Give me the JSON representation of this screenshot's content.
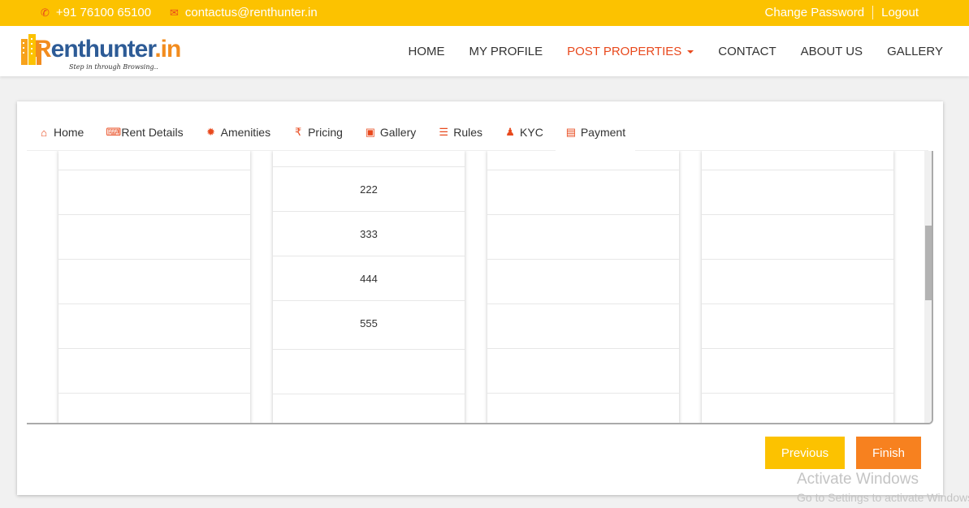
{
  "topbar": {
    "phone": "+91 76100 65100",
    "email": "contactus@renthunter.in",
    "change_password": "Change Password",
    "logout": "Logout"
  },
  "logo": {
    "brand_r": "R",
    "brand_rest": "enthunter",
    "brand_in": ".in",
    "tagline": "Step in through Browsing.."
  },
  "nav": [
    {
      "label": "HOME"
    },
    {
      "label": "MY PROFILE"
    },
    {
      "label": "POST PROPERTIES"
    },
    {
      "label": "CONTACT"
    },
    {
      "label": "ABOUT US"
    },
    {
      "label": "GALLERY"
    }
  ],
  "tabs": [
    {
      "label": "Home",
      "icon": "home-icon"
    },
    {
      "label": "Rent Details",
      "icon": "keyboard-icon"
    },
    {
      "label": "Amenities",
      "icon": "sun-icon"
    },
    {
      "label": "Pricing",
      "icon": "rupee-icon"
    },
    {
      "label": "Gallery",
      "icon": "image-icon"
    },
    {
      "label": "Rules",
      "icon": "list-icon"
    },
    {
      "label": "KYC",
      "icon": "user-icon"
    },
    {
      "label": "Payment",
      "icon": "money-icon"
    }
  ],
  "columns": [
    {
      "cells": [
        "",
        "",
        "",
        "",
        "",
        ""
      ]
    },
    {
      "cells": [
        "",
        "222",
        "333",
        "444",
        "555",
        ""
      ]
    },
    {
      "cells": [
        "",
        "",
        "",
        "",
        "",
        ""
      ]
    },
    {
      "cells": [
        "",
        "",
        "",
        "",
        "",
        ""
      ]
    }
  ],
  "buttons": {
    "previous": "Previous",
    "finish": "Finish"
  },
  "watermark": {
    "line1": "Activate Windows",
    "line2": "Go to Settings to activate Windows."
  },
  "colors": {
    "topbar": "#fcc200",
    "accent": "#e8491d",
    "finish": "#f7811f"
  }
}
